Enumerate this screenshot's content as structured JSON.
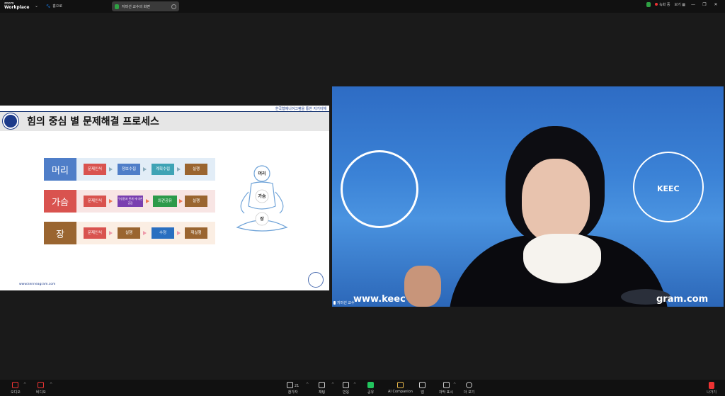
{
  "app": {
    "brand_top": "zoom",
    "brand_bottom": "Workplace",
    "home_label": "홈으로"
  },
  "meeting": {
    "title": "지미선 교수의 화면"
  },
  "top_right": {
    "recording": "녹화 중",
    "view": "보기"
  },
  "window_controls": [
    "—",
    "❐",
    "✕"
  ],
  "slide": {
    "top_note": "한국형에니어그램을 통한 자기이해",
    "title": "힘의 중심 별 문제해결 프로세스",
    "url": "www.kenneagram.com",
    "rows": [
      {
        "label": "머리",
        "steps": [
          "문제인식",
          "정보수집",
          "계획수립",
          "실행"
        ]
      },
      {
        "label": "가슴",
        "steps": [
          "문제인식",
          "구성원과 관계 에 대한 공감",
          "의견공유",
          "실행"
        ]
      },
      {
        "label": "장",
        "steps": [
          "문제인식",
          "실행",
          "수정",
          "재실행"
        ]
      }
    ],
    "body_labels": [
      "머리",
      "가슴",
      "장"
    ]
  },
  "video": {
    "participant_name": "지미선 교수",
    "keec": "KEEC",
    "url_left": "www.keec",
    "url_right": "gram.com"
  },
  "toolbar": {
    "audio": "오디오",
    "video": "비디오",
    "participants": "참가자",
    "participants_count": "21",
    "chat": "채팅",
    "react": "반응",
    "share": "공유",
    "ai": "AI Companion",
    "apps": "앱",
    "captions": "자막 표시",
    "more": "더 보기",
    "leave": "나가기"
  },
  "colors": {
    "head": "#4f7ec8",
    "heart": "#d9534f",
    "gut": "#9a6530",
    "video_bg": "#3b82d6",
    "recording": "#e33333"
  }
}
